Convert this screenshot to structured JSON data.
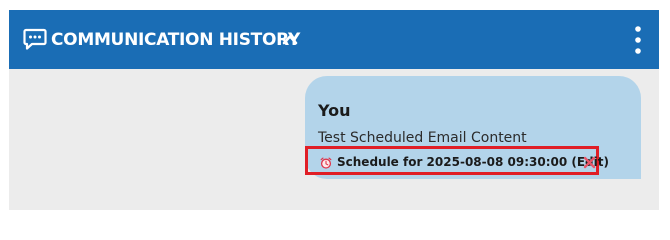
{
  "header": {
    "title": "COMMUNICATION HISTORY",
    "title_icon": "chat-bubble-icon",
    "collapse_icon": "chevron-up-icon",
    "menu_icon": "more-vertical-icon",
    "background_color": "#1a6db5"
  },
  "message": {
    "sender": "You",
    "body": "Test Scheduled Email Content",
    "bubble_color": "#b3d4ea",
    "schedule": {
      "label": "Schedule for 2025-08-08 09:30:00 (Edit)",
      "clock_icon": "alarm-clock-icon",
      "cancel_icon": "cancel-x-icon",
      "highlight_color": "#e01e26"
    }
  }
}
